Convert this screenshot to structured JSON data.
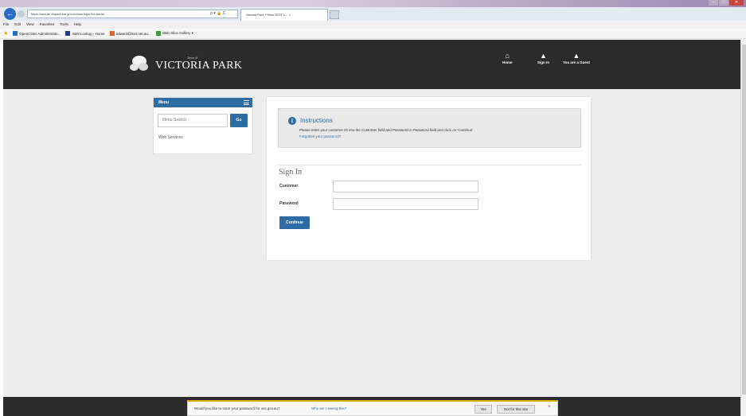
{
  "window": {
    "title": "",
    "controls": [
      "–",
      "□",
      "✕"
    ]
  },
  "browser": {
    "back_icon": "back-arrow-icon",
    "url": "https://secure.vicpark.wa.gov.au/userlogin?id=portal",
    "url_controls": "ρ ▾ 🔒 C",
    "tab_label": "Victoria Park **New TEST L... ×",
    "menus": [
      "File",
      "Edit",
      "View",
      "Favorites",
      "Tools",
      "Help"
    ],
    "favorites": [
      {
        "label": "OpenCities Administrato...",
        "color": "#1f6fd0"
      },
      {
        "label": "ABN Lookup - Home",
        "color": "#2b3c8a"
      },
      {
        "label": "edward@inet.net.au...",
        "color": "#e0612b"
      },
      {
        "label": "Web Slice Gallery ▾",
        "color": "#3a9a3a"
      }
    ]
  },
  "header": {
    "logo_top": "Town of",
    "logo_main": "VICTORIA PARK",
    "nav": [
      {
        "label": "Home",
        "icon": "home-icon"
      },
      {
        "label": "Sign In",
        "icon": "user-icon"
      },
      {
        "label": "You are a Guest",
        "icon": "user-icon"
      }
    ]
  },
  "sidebar": {
    "title": "Menu",
    "search_placeholder": "Menu Search",
    "go_label": "Go",
    "items": [
      "Web Services"
    ]
  },
  "instructions": {
    "title": "Instructions",
    "text": "Please enter your customer ID into the Customer field and Password in Password field and click on 'Continue'",
    "link": "Forgotten your password?"
  },
  "signin": {
    "title": "Sign In",
    "customer_label": "Customer",
    "customer_value": "",
    "password_label": "Password",
    "password_value": "",
    "continue_label": "Continue"
  },
  "notification": {
    "text": "Would you like to store your password for vvs.gov.au?",
    "link": "Why am I seeing this?",
    "yes_label": "Yes",
    "no_label": "Not for this site",
    "close": "×"
  },
  "colors": {
    "primary": "#2e6da4",
    "header_bg": "#2b2b2b",
    "page_bg": "#ededed"
  }
}
